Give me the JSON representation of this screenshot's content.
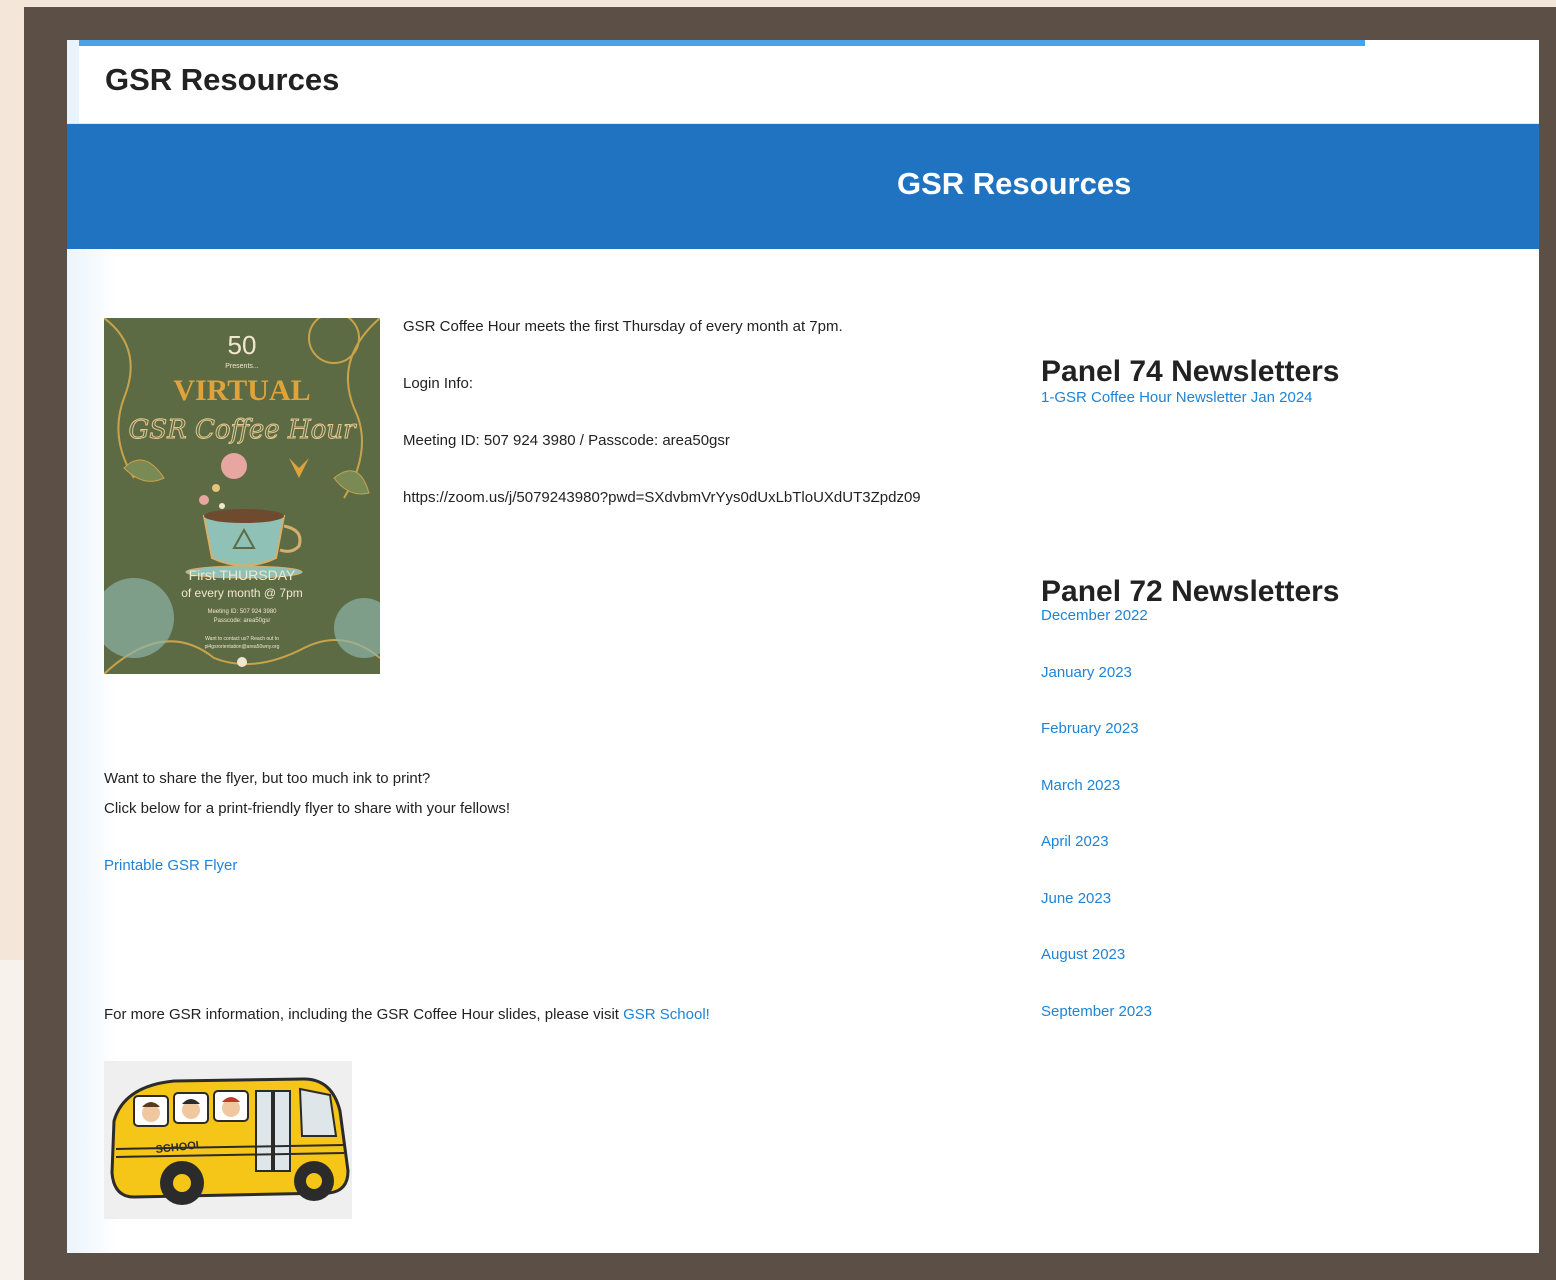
{
  "window": {
    "title": "GSR Resources"
  },
  "banner": {
    "title": "GSR Resources"
  },
  "flyer_image": {
    "alt": "Virtual GSR Coffee Hour flyer",
    "number": "50",
    "presents": "Presents...",
    "virtual": "VIRTUAL",
    "script": "GSR Coffee Hour",
    "line1": "First THURSDAY",
    "line2": "of every month @ 7pm",
    "meeting": "Meeting ID: 507 924 3980",
    "passcode": "Passcode: area50gsr",
    "contact": "Want to contact us? Reach out to",
    "email": "pl4gsrorientation@area50wny.org"
  },
  "coffee_hour": {
    "schedule": "GSR Coffee Hour meets the first Thursday of every month at 7pm.",
    "login_label": "Login Info:",
    "meeting_id": "Meeting ID: 507 924 3980 / Passcode: area50gsr",
    "zoom_url": "https://zoom.us/j/5079243980?pwd=SXdvbmVrYys0dUxLbTloUXdUT3Zpdz09"
  },
  "share": {
    "line1": "Want to share the flyer, but too much ink to print?",
    "line2": "Click below for a print-friendly flyer to share with your fellows!",
    "link": "Printable GSR Flyer"
  },
  "more_info": {
    "text": "For more GSR information, including the GSR Coffee Hour slides, please visit ",
    "link": "GSR School!"
  },
  "bus_image": {
    "label": "SCHOOL"
  },
  "panel74": {
    "heading": "Panel 74 Newsletters",
    "links": [
      "1-GSR Coffee Hour Newsletter Jan 2024"
    ]
  },
  "panel72": {
    "heading": "Panel 72 Newsletters",
    "links": [
      "December 2022",
      "January 2023",
      "February 2023",
      "March 2023",
      "April 2023",
      "June 2023",
      "August 2023",
      "September 2023"
    ]
  },
  "colors": {
    "banner": "#1f73c0",
    "link": "#1f83d6",
    "frame": "#5b4f46",
    "flyer_bg": "#5d6b45"
  }
}
